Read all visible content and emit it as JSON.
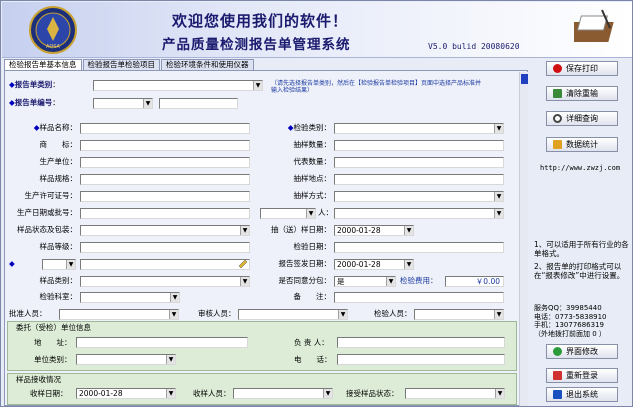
{
  "header": {
    "welcome": "欢迎您使用我们的软件！",
    "title": "产品质量检测报告单管理系统",
    "version": "V5.0  bulid 20080620"
  },
  "tabs": [
    {
      "label": "检验报告单基本信息"
    },
    {
      "label": "检验报告单检验项目"
    },
    {
      "label": "检验环境条件和使用仪器"
    }
  ],
  "form": {
    "report_type_label": "报告单类别",
    "report_no_label": "报告单编号",
    "hint": "（请先选择报告单类别，然后在【检验报告单检验项目】页面中选择产品标准并输入检验结果）",
    "left_labels": [
      "样品名称",
      "商　　标",
      "生产单位",
      "样品规格",
      "生产许可证号",
      "生产日期或批号",
      "样品状态及包装",
      "样品等级",
      "",
      "样品类别",
      "检验科室"
    ],
    "right_labels": [
      "检验类别",
      "抽样数量",
      "代表数量",
      "抽样地点",
      "抽样方式",
      "人",
      "抽（送）样日期",
      "检验日期",
      "报告签发日期",
      "是否同意分包",
      "备　　注"
    ],
    "sample_date": "2000-01-28",
    "issue_date": "2000-01-28",
    "subcontract": "是",
    "fee_label": "检验费用",
    "fee_value": "￥0.00",
    "approver_label": "批准人员",
    "reviewer_label": "审核人员",
    "inspector_label": "检验人员"
  },
  "client": {
    "title": "委托（受检）单位信息",
    "address_label": "地　　址",
    "unit_type_label": "单位类别",
    "contact_label": "负 责 人",
    "phone_label": "电　　话"
  },
  "receipt": {
    "title": "样品接收情况",
    "date_label": "收样日期",
    "date_value": "2000-01-28",
    "receiver_label": "收样人员",
    "status_label": "接受样品状态"
  },
  "buttons": {
    "save_print": "保存打印",
    "clear": "清除重输",
    "detail": "详细查询",
    "stats": "数据统计",
    "modify": "界面修改",
    "relogin": "重新登录",
    "exit": "退出系统"
  },
  "side": {
    "url": "http://www.zwzj.com",
    "note1": "1、可以适用于所有行业的各单格式。",
    "note2": "2、报告单的打印格式可以在“报表修改”中进行设置。",
    "contact": [
      "服务QQ：39985440",
      "电话：0773-5838910",
      "手机：13077686319",
      "（外地拨打前面加 0 ）"
    ]
  },
  "colors": {
    "title": "#1a1a6e",
    "accent": "#2040c0",
    "section": "#dcecd6"
  }
}
